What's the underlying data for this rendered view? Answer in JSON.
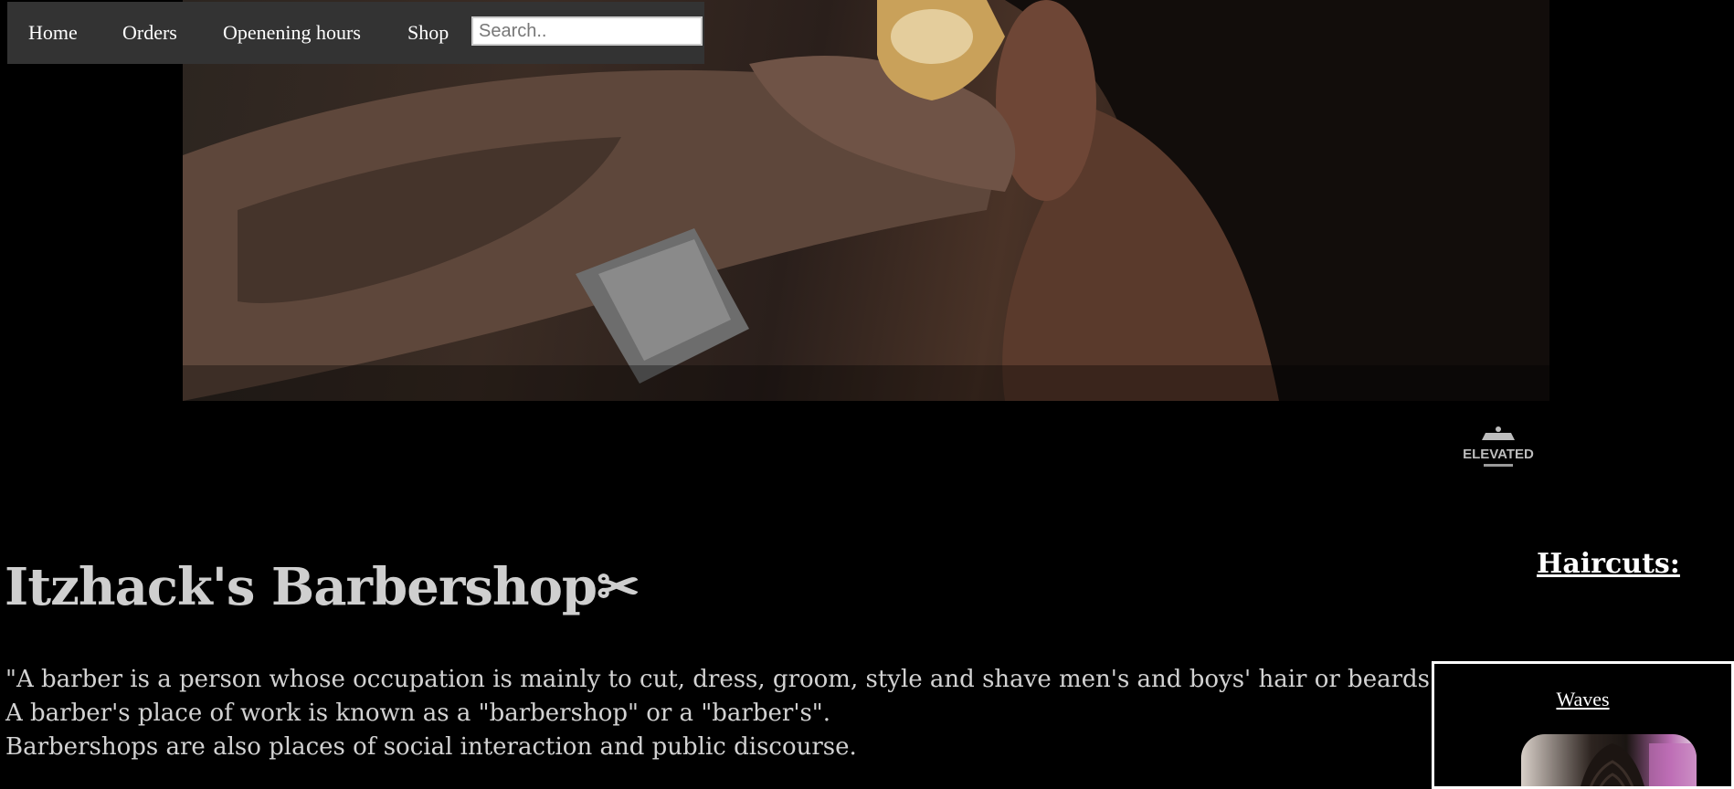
{
  "nav": {
    "items": [
      {
        "label": "Home"
      },
      {
        "label": "Orders"
      },
      {
        "label": "Openening hours"
      },
      {
        "label": "Shop"
      }
    ],
    "search_placeholder": "Search.."
  },
  "hero": {
    "description": "Close-up of a barber trimming hair with clippers",
    "logo_text": "ELEVATED"
  },
  "main": {
    "title": "Itzhack's Barbershop✂",
    "quote_lines": [
      "\"A barber is a person whose occupation is mainly to cut, dress, groom, style and shave men's and boys' hair or beards.",
      "A barber's place of work is known as a \"barbershop\" or a \"barber's\".",
      "Barbershops are also places of social interaction and public discourse."
    ]
  },
  "haircuts": {
    "heading": "Haircuts:",
    "cards": [
      {
        "title": "Waves"
      }
    ]
  },
  "colors": {
    "background": "#000000",
    "nav_bg": "#333333",
    "text": "#d2d2d2"
  }
}
